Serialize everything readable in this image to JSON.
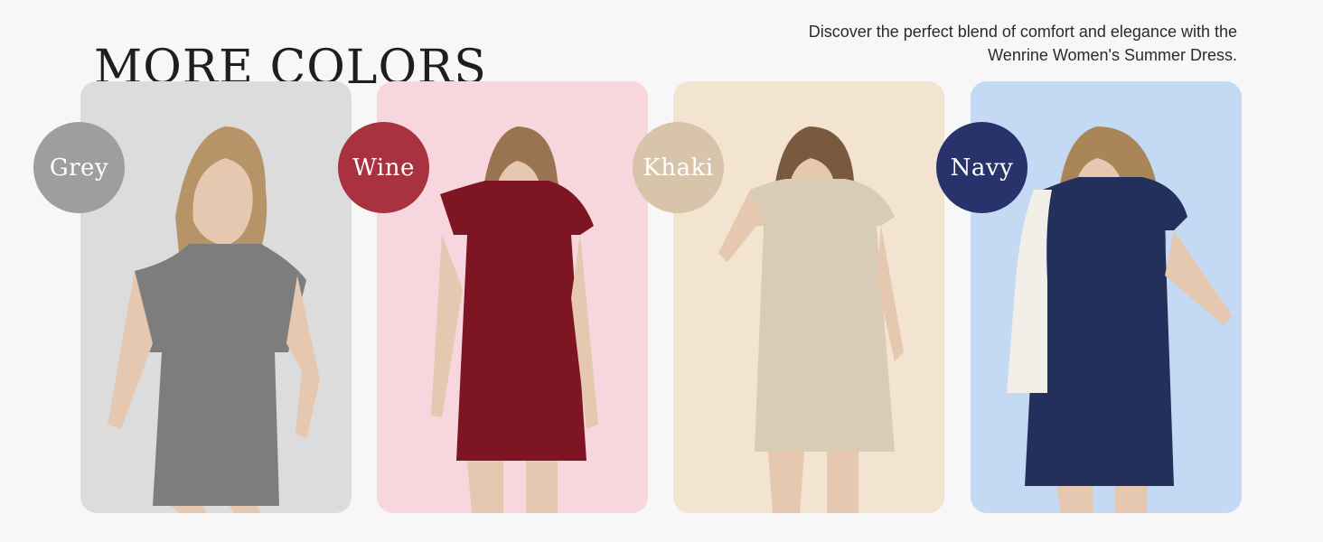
{
  "header": {
    "title": "MORE COLORS",
    "tagline_line1": "Discover the perfect blend of comfort and elegance with the",
    "tagline_line2": "Wenrine Women's Summer Dress."
  },
  "colors": [
    {
      "label": "Grey",
      "card_bg": "#dcdcdc",
      "badge_bg": "#9e9e9e",
      "dress": "#7d7d7d"
    },
    {
      "label": "Wine",
      "card_bg": "#f7d6de",
      "badge_bg": "#a8323f",
      "dress": "#7d1622"
    },
    {
      "label": "Khaki",
      "card_bg": "#f2e4d0",
      "badge_bg": "#d8c4ab",
      "dress": "#d9ccb6"
    },
    {
      "label": "Navy",
      "card_bg": "#c4d9f4",
      "badge_bg": "#27336a",
      "dress": "#23305c"
    }
  ]
}
